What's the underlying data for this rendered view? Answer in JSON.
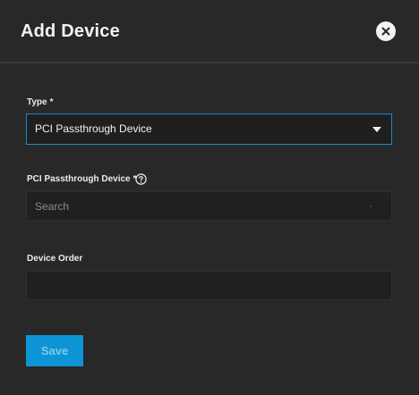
{
  "dialog": {
    "title": "Add Device",
    "close_icon": "close-circle-icon"
  },
  "form": {
    "type": {
      "label": "Type",
      "required_mark": "*",
      "value": "PCI Passthrough Device",
      "icon": "chevron-down-icon"
    },
    "pci_device": {
      "label": "PCI Passthrough Device",
      "required_mark": "*",
      "placeholder": "Search",
      "value": "",
      "help_icon": "help-circle-icon"
    },
    "device_order": {
      "label": "Device Order",
      "value": ""
    }
  },
  "actions": {
    "save_label": "Save"
  },
  "colors": {
    "background": "#282828",
    "field_background": "#202020",
    "accent": "#0d95d6",
    "text": "#f2f2f2",
    "placeholder": "#8a8a8a"
  }
}
